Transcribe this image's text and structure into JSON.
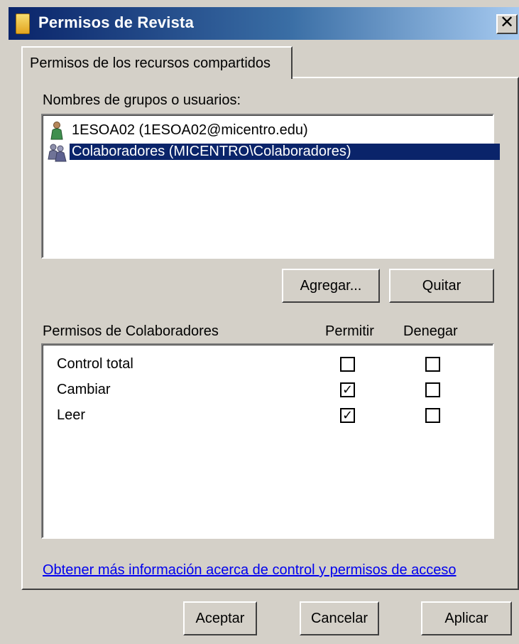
{
  "window": {
    "title": "Permisos de Revista",
    "close_glyph": "✕"
  },
  "tab": {
    "label": "Permisos de los recursos compartidos"
  },
  "users": {
    "label": "Nombres de grupos o usuarios:",
    "items": [
      {
        "text": "1ESOA02 (1ESOA02@micentro.edu)",
        "icon": "user-icon",
        "selected": false
      },
      {
        "text": "Colaboradores (MICENTRO\\Colaboradores)",
        "icon": "group-icon",
        "selected": true
      }
    ]
  },
  "buttons": {
    "add": "Agregar...",
    "remove": "Quitar",
    "ok": "Aceptar",
    "cancel": "Cancelar",
    "apply": "Aplicar"
  },
  "permissions": {
    "title": "Permisos de Colaboradores",
    "allow_header": "Permitir",
    "deny_header": "Denegar",
    "rows": [
      {
        "name": "Control total",
        "allow": false,
        "deny": false
      },
      {
        "name": "Cambiar",
        "allow": true,
        "deny": false
      },
      {
        "name": "Leer",
        "allow": true,
        "deny": false
      }
    ]
  },
  "help_link": "Obtener más información acerca de control y permisos de acceso",
  "colors": {
    "titlebar_start": "#0a246a",
    "titlebar_end": "#a6caf0",
    "selection": "#0a246a",
    "dialog_bg": "#d4d0c8",
    "link": "#0000ee"
  }
}
